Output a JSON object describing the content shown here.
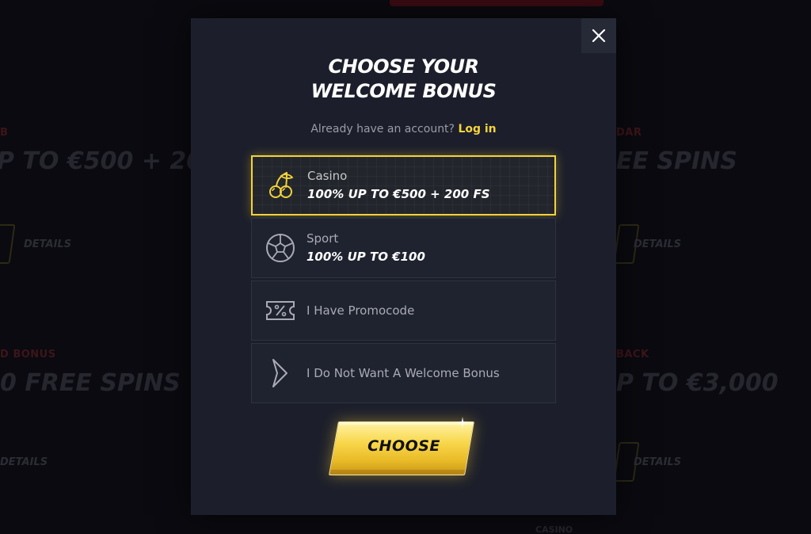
{
  "background": {
    "left_labels": [
      "B",
      "D BONUS"
    ],
    "right_labels": [
      "DAR",
      "BACK"
    ],
    "left_bigs": [
      "P TO €500 + 200",
      "0 FREE SPINS"
    ],
    "right_bigs": [
      "EE SPINS",
      "P TO €3,000"
    ],
    "details": "DETAILS",
    "bottom_small": "CASINO"
  },
  "modal": {
    "title_line1": "CHOOSE YOUR",
    "title_line2": "WELCOME BONUS",
    "account_prompt": "Already have an account?",
    "login_link": "Log in",
    "close_icon": "close-icon",
    "options": [
      {
        "title": "Casino",
        "subtitle": "100% UP TO €500 + 200 FS",
        "icon": "cherries-icon",
        "selected": true
      },
      {
        "title": "Sport",
        "subtitle": "100% UP TO €100",
        "icon": "soccer-ball-icon",
        "selected": false
      },
      {
        "title": "I Have Promocode",
        "icon": "ticket-percent-icon",
        "selected": false
      },
      {
        "title": "I Do Not Want A Welcome Bonus",
        "icon": "chevron-right-icon",
        "selected": false
      }
    ],
    "choose_button": "CHOOSE"
  },
  "colors": {
    "accent": "#f2d23b",
    "modal_bg": "#1c1f2b",
    "option_bg": "#1f2330"
  }
}
